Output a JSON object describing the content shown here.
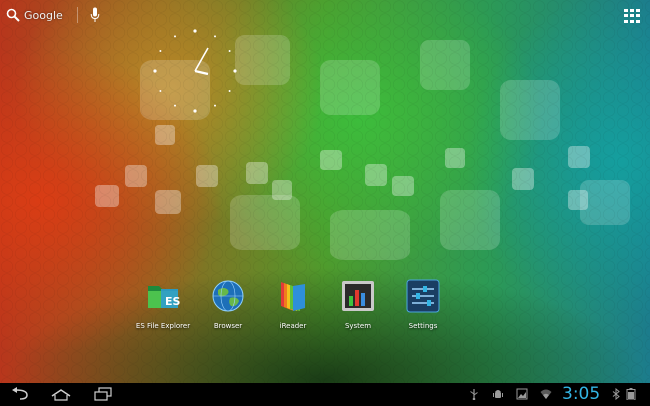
{
  "search": {
    "label": "Google"
  },
  "apps": [
    {
      "label": "ES File Explorer"
    },
    {
      "label": "Browser"
    },
    {
      "label": "iReader"
    },
    {
      "label": "System"
    },
    {
      "label": "Settings"
    }
  ],
  "status": {
    "time": "3:05"
  },
  "colors": {
    "accent": "#33b5e5",
    "sysbar": "#000000"
  },
  "icons": {
    "search": "search-icon",
    "mic": "microphone-icon",
    "apps": "all-apps-grid-icon",
    "back": "back-icon",
    "home": "home-icon",
    "recents": "recent-apps-icon",
    "usb": "usb-icon",
    "debug": "android-debug-icon",
    "screenshot": "image-notification-icon",
    "wifi": "wifi-icon",
    "bluetooth": "bluetooth-icon",
    "battery": "battery-icon"
  }
}
